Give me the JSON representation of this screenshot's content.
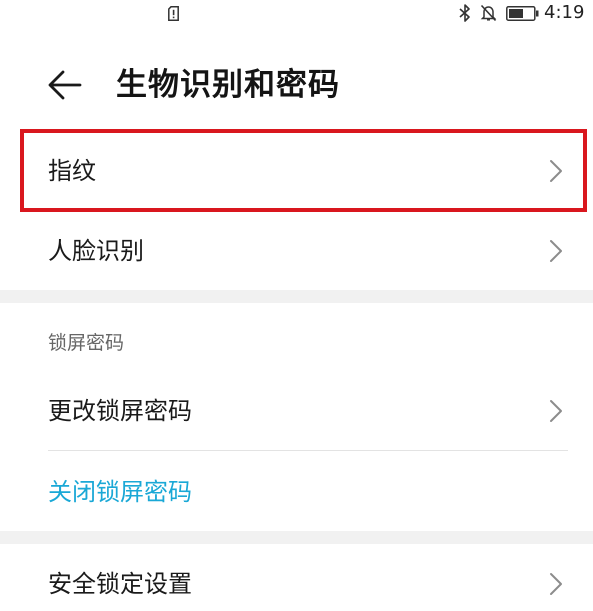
{
  "status_bar": {
    "time": "4:19",
    "icons": [
      "sim-alert-icon",
      "bluetooth-icon",
      "notifications-off-icon",
      "battery-icon"
    ]
  },
  "header": {
    "title": "生物识别和密码",
    "back_icon": "arrow-left-icon"
  },
  "items": [
    {
      "label": "指纹",
      "chevron": "chevron-right-icon",
      "highlighted": true
    },
    {
      "label": "人脸识别",
      "chevron": "chevron-right-icon"
    }
  ],
  "lock_section": {
    "title": "锁屏密码",
    "items": [
      {
        "label": "更改锁屏密码",
        "chevron": "chevron-right-icon"
      },
      {
        "label": "关闭锁屏密码"
      }
    ]
  },
  "security_section": {
    "items": [
      {
        "label": "安全锁定设置",
        "chevron": "chevron-right-icon"
      }
    ]
  },
  "colors": {
    "highlight_border": "#d9171e",
    "link_text": "#1aa8d6",
    "section_gap": "#f1f1f1",
    "section_title": "#666666"
  }
}
